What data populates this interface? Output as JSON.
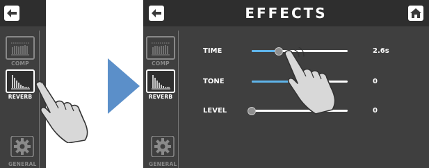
{
  "sidebar": {
    "items": [
      {
        "label": "COMP",
        "icon": "comp-meter-icon"
      },
      {
        "label": "REVERB",
        "icon": "reverb-bars-icon"
      },
      {
        "label": "GENERAL",
        "icon": "gear-icon"
      }
    ]
  },
  "header": {
    "title": "EFFECTS"
  },
  "params": [
    {
      "label": "TIME",
      "value": "2.6s",
      "level": 0.28
    },
    {
      "label": "TONE",
      "value": "0",
      "level": 0.5
    },
    {
      "label": "LEVEL",
      "value": "0",
      "level": 0.0
    }
  ],
  "colors": {
    "panel": "#3f3f3f",
    "titlebar": "#2e2e2e",
    "accent": "#5fb4ea",
    "arrow": "#5b8fc9"
  }
}
